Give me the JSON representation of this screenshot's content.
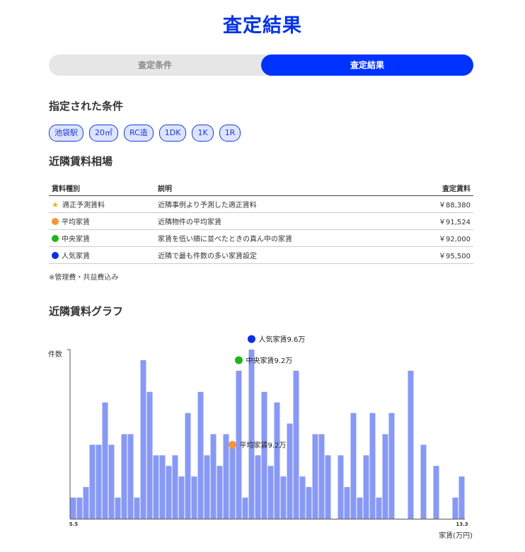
{
  "page_title": "査定結果",
  "tabs": [
    {
      "label": "査定条件",
      "active": false
    },
    {
      "label": "査定結果",
      "active": true
    }
  ],
  "conditions": {
    "title": "指定された条件",
    "chips": [
      "池袋駅",
      "20㎡",
      "RC造",
      "1DK",
      "1K",
      "1R"
    ]
  },
  "market": {
    "title": "近隣賃料相場",
    "headers": {
      "type": "賃料種別",
      "description": "説明",
      "price": "査定賃料"
    },
    "rows": [
      {
        "type": "適正予測賃料",
        "description": "近隣事例より予測した適正賃料",
        "price": "￥88,380",
        "marker": "star-icon",
        "color": "#f2c200"
      },
      {
        "type": "平均家賃",
        "description": "近隣物件の平均家賃",
        "price": "￥91,524",
        "marker": "dot",
        "color": "#f5953a"
      },
      {
        "type": "中央家賃",
        "description": "家賃を低い順に並べたときの真ん中の家賃",
        "price": "￥92,000",
        "marker": "dot",
        "color": "#1db51d"
      },
      {
        "type": "人気家賃",
        "description": "近隣で最も件数の多い家賃設定",
        "price": "￥95,500",
        "marker": "dot",
        "color": "#0a2ee8"
      }
    ],
    "note": "※管理費・共益費込み"
  },
  "graph": {
    "title": "近隣賃料グラフ",
    "bar_color": "#8899f5",
    "chart_data": {
      "type": "bar",
      "ylabel": "件数",
      "xlabel": "家賃(万円)",
      "x_tick_labels": [
        "5.5",
        "13.3"
      ],
      "values": [
        1,
        1,
        1.5,
        3.5,
        3.5,
        5.5,
        3.5,
        1,
        4,
        4,
        1,
        7.5,
        6,
        3,
        3,
        2.5,
        3,
        2,
        5,
        2,
        6,
        3,
        4,
        2.5,
        4,
        3.5,
        7,
        1,
        8,
        3,
        6,
        2.5,
        5.5,
        2,
        4.5,
        7,
        2,
        1.5,
        4,
        4,
        3,
        0,
        3,
        1.5,
        5,
        1,
        3,
        5,
        1,
        4,
        5,
        0,
        0,
        7,
        0,
        3.5,
        0,
        2.5,
        0,
        0,
        1,
        2
      ],
      "ylim": [
        0,
        8
      ],
      "annotations": [
        {
          "label": "人気家賃9.6万",
          "bar_index": 28,
          "value": 8.5,
          "color": "#0a2ee8"
        },
        {
          "label": "中央家賃9.2万",
          "bar_index": 26,
          "value": 7.5,
          "color": "#1db51d"
        },
        {
          "label": "平均家賃9.2万",
          "bar_index": 25,
          "value": 3.5,
          "color": "#f5953a"
        }
      ]
    }
  }
}
